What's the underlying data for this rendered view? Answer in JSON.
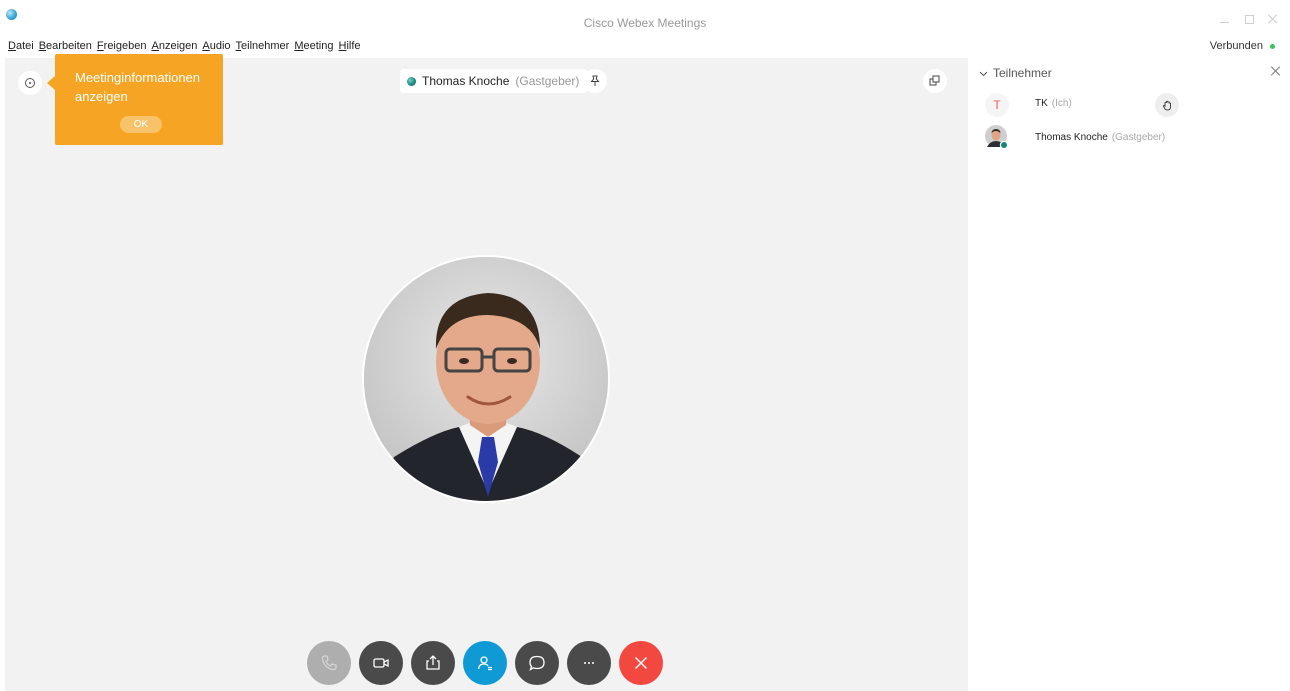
{
  "window": {
    "title": "Cisco Webex Meetings"
  },
  "menu": [
    "Datei",
    "Bearbeiten",
    "Freigeben",
    "Anzeigen",
    "Audio",
    "Teilnehmer",
    "Meeting",
    "Hilfe"
  ],
  "status": {
    "text": "Verbunden",
    "color": "#34c759"
  },
  "tooltip": {
    "text": "Meetinginformationen anzeigen",
    "ok_label": "OK",
    "color": "#f5a523"
  },
  "host": {
    "name": "Thomas Knoche",
    "role": "(Gastgeber)"
  },
  "controls": [
    {
      "name": "mute-button",
      "icon": "phone-icon"
    },
    {
      "name": "video-button",
      "icon": "video-camera-icon"
    },
    {
      "name": "share-button",
      "icon": "share-upload-icon"
    },
    {
      "name": "participants-button",
      "icon": "participants-icon"
    },
    {
      "name": "chat-button",
      "icon": "chat-bubble-icon"
    },
    {
      "name": "more-button",
      "icon": "more-dots-icon"
    },
    {
      "name": "leave-button",
      "icon": "close-x-icon"
    }
  ],
  "panel": {
    "title": "Teilnehmer",
    "participants": [
      {
        "initial": "T",
        "name": "TK",
        "role": "(Ich)"
      },
      {
        "name": "Thomas Knoche",
        "role": "(Gastgeber)"
      }
    ]
  }
}
